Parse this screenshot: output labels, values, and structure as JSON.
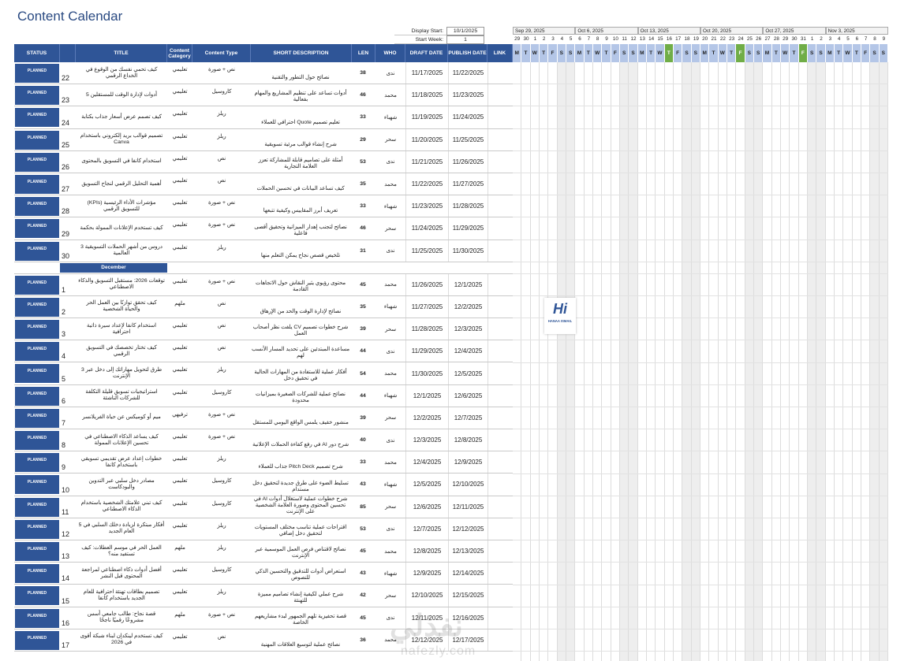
{
  "page_title": "Content Calendar",
  "settings": {
    "display_start_label": "Display Start:",
    "display_start_value": "10/1/2025",
    "start_week_label": "Start Week:",
    "start_week_value": "1"
  },
  "columns": {
    "status": "STATUS",
    "title": "TITLE",
    "category": "Content Category",
    "type": "Content Type",
    "desc": "SHORT DESCRIPTION",
    "len": "LEN",
    "who": "WHO",
    "draft": "DRAFT DATE",
    "publish": "PUBLISH DATE",
    "link": "LINK"
  },
  "status_label": "PLANNED",
  "month_divider": "December",
  "rows_oct": [
    {
      "num": "22",
      "title": "كيف تحمي نفسك من الوقوع في الخداع الرقمي",
      "cat": "تعليمي",
      "type": "نص + صورة",
      "desc": "نصائح حول التطور والتقنية",
      "len": "38",
      "who": "ندى",
      "draft": "11/17/2025",
      "pub": "11/22/2025"
    },
    {
      "num": "23",
      "title": "أدوات لإدارة الوقت للمستقلين 5",
      "cat": "تعليمي",
      "type": "كاروسيل",
      "desc": "أدوات تساعد على تنظيم المشاريع والمهام بفعالية",
      "len": "46",
      "who": "محمد",
      "draft": "11/18/2025",
      "pub": "11/23/2025"
    },
    {
      "num": "24",
      "title": "كيف تصمم عرض أسعار جذاب بكتابة",
      "cat": "تعليمي",
      "type": "ريلز",
      "desc": "تعليم تصميم Quote احترافي للعملاء",
      "len": "33",
      "who": "شهباء",
      "draft": "11/19/2025",
      "pub": "11/24/2025"
    },
    {
      "num": "25",
      "title": "تصميم قوالب بريد إلكتروني باستخدام Canva",
      "cat": "تعليمي",
      "type": "ريلز",
      "desc": "شرح إنشاء قوالب مرئية تسويقية",
      "len": "29",
      "who": "سحر",
      "draft": "11/20/2025",
      "pub": "11/25/2025"
    },
    {
      "num": "26",
      "title": "استخدام كانفا في التسويق بالمحتوى",
      "cat": "تعليمي",
      "type": "نص",
      "desc": "أمثلة على تصاميم قابلة للمشاركة تعزز العلامة التجارية",
      "len": "53",
      "who": "ندى",
      "draft": "11/21/2025",
      "pub": "11/26/2025"
    },
    {
      "num": "27",
      "title": "أهمية التحليل الرقمي لنجاح التسويق",
      "cat": "تعليمي",
      "type": "نص",
      "desc": "كيف تساعد البيانات في تحسين الحملات",
      "len": "35",
      "who": "محمد",
      "draft": "11/22/2025",
      "pub": "11/27/2025"
    },
    {
      "num": "28",
      "title": "مؤشرات الأداء الرئيسية (KPIs) للتسويق الرقمي",
      "cat": "تعليمي",
      "type": "نص + صورة",
      "desc": "تعريف أبرز المقاييس وكيفية تتبعها",
      "len": "33",
      "who": "شهباء",
      "draft": "11/23/2025",
      "pub": "11/28/2025"
    },
    {
      "num": "29",
      "title": "كيف تستخدم الإعلانات الممولة بحكمة",
      "cat": "تعليمي",
      "type": "نص + صورة",
      "desc": "نصائح لتجنب إهدار الميزانية وتحقيق أقصى فاعلية",
      "len": "46",
      "who": "سحر",
      "draft": "11/24/2025",
      "pub": "11/29/2025"
    },
    {
      "num": "30",
      "title": "دروس من أشهر الحملات التسويقية 3 العالمية",
      "cat": "تعليمي",
      "type": "ريلز",
      "desc": "تلخيص قصص نجاح يمكن التعلم منها",
      "len": "31",
      "who": "ندى",
      "draft": "11/25/2025",
      "pub": "11/30/2025"
    }
  ],
  "rows_dec": [
    {
      "num": "1",
      "title": "توقعات 2026: مستقبل التسويق والذكاء الاصطناعي",
      "cat": "تعليمي",
      "type": "نص + صورة",
      "desc": "محتوى رؤيوي يثير النقاش حول الاتجاهات القادمة",
      "len": "45",
      "who": "محمد",
      "draft": "11/26/2025",
      "pub": "12/1/2025"
    },
    {
      "num": "2",
      "title": "كيف تحقق توازنًا بين العمل الحر والحياة الشخصية",
      "cat": "ملهم",
      "type": "نص",
      "desc": "نصائح لإدارة الوقت والحد من الإرهاق",
      "len": "35",
      "who": "شهباء",
      "draft": "11/27/2025",
      "pub": "12/2/2025"
    },
    {
      "num": "3",
      "title": "استخدام كانفا لإعداد سيرة ذاتية احترافية",
      "cat": "تعليمي",
      "type": "نص",
      "desc": "شرح خطوات تصميم CV يلفت نظر أصحاب العمل",
      "len": "39",
      "who": "سحر",
      "draft": "11/28/2025",
      "pub": "12/3/2025"
    },
    {
      "num": "4",
      "title": "كيف تختار تخصصك في التسويق الرقمي",
      "cat": "تعليمي",
      "type": "نص",
      "desc": "مساعدة المبتدئين على تحديد المسار الأنسب لهم",
      "len": "44",
      "who": "ندى",
      "draft": "11/29/2025",
      "pub": "12/4/2025"
    },
    {
      "num": "5",
      "title": "طرق لتحويل مهاراتك إلى دخل عبر 3 الإنترنت",
      "cat": "تعليمي",
      "type": "ريلز",
      "desc": "أفكار عملية للاستفادة من المهارات الحالية في تحقيق دخل",
      "len": "54",
      "who": "محمد",
      "draft": "11/30/2025",
      "pub": "12/5/2025"
    },
    {
      "num": "6",
      "title": "استراتيجيات تسويق قليلة التكلفة للشركات الناشئة",
      "cat": "تعليمي",
      "type": "كاروسيل",
      "desc": "نصائح عملية للشركات الصغيرة بميزانيات محدودة",
      "len": "44",
      "who": "شهباء",
      "draft": "12/1/2025",
      "pub": "12/6/2025"
    },
    {
      "num": "7",
      "title": "ميم أو كوميكس عن حياة الفريلانسر",
      "cat": "ترفيهي",
      "type": "نص + صورة",
      "desc": "منشور خفيف يلمس الواقع اليومي للمستقل",
      "len": "39",
      "who": "سحر",
      "draft": "12/2/2025",
      "pub": "12/7/2025"
    },
    {
      "num": "8",
      "title": "كيف يساعد الذكاء الاصطناعي في تحسين الإعلانات الممولة",
      "cat": "تعليمي",
      "type": "نص + صورة",
      "desc": "شرح دور AI في رفع كفاءة الحملات الإعلانية",
      "len": "40",
      "who": "ندى",
      "draft": "12/3/2025",
      "pub": "12/8/2025"
    },
    {
      "num": "9",
      "title": "خطوات إعداد عرض تقديمي تسويقي باستخدام كانفا",
      "cat": "تعليمي",
      "type": "ريلز",
      "desc": "شرح تصميم Pitch Deck جذاب للعملاء",
      "len": "33",
      "who": "محمد",
      "draft": "12/4/2025",
      "pub": "12/9/2025"
    },
    {
      "num": "10",
      "title": "مصادر دخل سلبي عبر التدوين والبودكاست",
      "cat": "تعليمي",
      "type": "كاروسيل",
      "desc": "تسليط الضوء على طرق جديدة لتحقيق دخل مستدام",
      "len": "43",
      "who": "شهباء",
      "draft": "12/5/2025",
      "pub": "12/10/2025"
    },
    {
      "num": "11",
      "title": "كيف تبني علامتك الشخصية باستخدام الذكاء الاصطناعي",
      "cat": "تعليمي",
      "type": "كاروسيل",
      "desc": "شرح خطوات عملية لاستغلال أدوات AI في تحسين المحتوى وصورة العلامة الشخصية على الإنترنت",
      "len": "85",
      "who": "سحر",
      "draft": "12/6/2025",
      "pub": "12/11/2025"
    },
    {
      "num": "12",
      "title": "أفكار مبتكرة لزيادة دخلك السلبي في 5 العام الجديد",
      "cat": "تعليمي",
      "type": "ريلز",
      "desc": "اقتراحات عملية تناسب مختلف المستويات لتحقيق دخل إضافي",
      "len": "53",
      "who": "ندى",
      "draft": "12/7/2025",
      "pub": "12/12/2025"
    },
    {
      "num": "13",
      "title": "العمل الحر في موسم العطلات: كيف تستفيد منه؟",
      "cat": "ملهم",
      "type": "ريلز",
      "desc": "نصائح لاقتناص فرص العمل الموسمية عبر الإنترنت",
      "len": "45",
      "who": "محمد",
      "draft": "12/8/2025",
      "pub": "12/13/2025"
    },
    {
      "num": "14",
      "title": "أفضل أدوات ذكاء اصطناعي لمراجعة المحتوى قبل النشر",
      "cat": "تعليمي",
      "type": "كاروسيل",
      "desc": "استعراض أدوات للتدقيق والتحسين الذكي للنصوص",
      "len": "43",
      "who": "شهباء",
      "draft": "12/9/2025",
      "pub": "12/14/2025"
    },
    {
      "num": "15",
      "title": "تصميم بطاقات تهنئة احترافية للعام الجديد باستخدام كانفا",
      "cat": "تعليمي",
      "type": "ريلز",
      "desc": "شرح عملي لكيفية إنشاء تصاميم مميزة للتهنئة",
      "len": "42",
      "who": "سحر",
      "draft": "12/10/2025",
      "pub": "12/15/2025"
    },
    {
      "num": "16",
      "title": "قصة نجاح: طالب جامعي أسس مشروعًا رقميًا ناجحًا",
      "cat": "ملهم",
      "type": "نص + صورة",
      "desc": "قصة تحفيزية تلهم الجمهور لبدء مشاريعهم الخاصة",
      "len": "45",
      "who": "ندى",
      "draft": "12/11/2025",
      "pub": "12/16/2025"
    },
    {
      "num": "17",
      "title": "كيف تستخدم لينكدإن لبناء شبكة أقوى في 2026",
      "cat": "تعليمي",
      "type": "نص",
      "desc": "نصائح عملية لتوسيع العلاقات المهنية",
      "len": "36",
      "who": "محمد",
      "draft": "12/12/2025",
      "pub": "12/17/2025"
    }
  ],
  "weeks": [
    {
      "label": "Sep 29, 2025",
      "days": [
        "29",
        "30",
        "1",
        "2",
        "3",
        "4",
        "5"
      ]
    },
    {
      "label": "Oct 6, 2025",
      "days": [
        "6",
        "7",
        "8",
        "9",
        "10",
        "11",
        "12"
      ]
    },
    {
      "label": "Oct 13, 2025",
      "days": [
        "13",
        "14",
        "15",
        "16",
        "17",
        "18",
        "19"
      ]
    },
    {
      "label": "Oct 20, 2025",
      "days": [
        "20",
        "21",
        "22",
        "23",
        "24",
        "25",
        "26"
      ]
    },
    {
      "label": "Oct 27, 2025",
      "days": [
        "27",
        "28",
        "29",
        "30",
        "31",
        "1",
        "2"
      ]
    },
    {
      "label": "Nov 3, 2025",
      "days": [
        "3",
        "4",
        "5",
        "6",
        "7",
        "8",
        "9"
      ]
    }
  ],
  "day_letters": [
    "M",
    "T",
    "W",
    "T",
    "F",
    "S",
    "S"
  ],
  "highlighted_days": [
    [
      2,
      3
    ],
    [
      3,
      4
    ],
    [
      4,
      4
    ]
  ],
  "logo": {
    "mark": "Hi",
    "name": "HANAA ISMAIL"
  },
  "watermark": {
    "text": "نفذلي",
    "url": "nafezly.com"
  },
  "colors": {
    "header_blue": "#2f5597",
    "day_header": "#b4c6e7",
    "today_green": "#70ad47"
  }
}
